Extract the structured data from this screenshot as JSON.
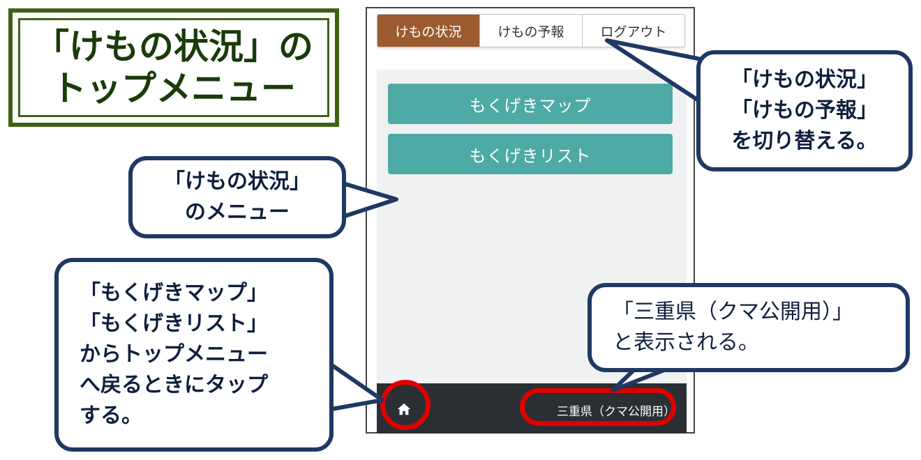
{
  "title": {
    "line1": "「けもの状況」の",
    "line2": "トップメニュー"
  },
  "phone": {
    "tabs": [
      {
        "label": "けもの状況",
        "active": true
      },
      {
        "label": "けもの予報",
        "active": false
      },
      {
        "label": "ログアウト",
        "active": false
      }
    ],
    "menu": {
      "map_button": "もくげきマップ",
      "list_button": "もくげきリスト"
    },
    "footer": {
      "home_icon": "home-icon",
      "region": "三重県（クマ公開用）"
    },
    "colors": {
      "active_tab": "#9c5b2e",
      "menu_button": "#4eaaa4",
      "footer": "#2a2f33",
      "highlight": "#e00000"
    }
  },
  "callouts": {
    "tabs": {
      "line1": "「けもの状況」",
      "line2": "「けもの予報」",
      "line3": "を切り替える。"
    },
    "menu": {
      "line1": "「けもの状況」",
      "line2": "のメニュー"
    },
    "home": {
      "line1": "「もくげきマップ」",
      "line2": "「もくげきリスト」",
      "line3": "からトップメニュー",
      "line4": "へ戻るときにタップ",
      "line5": "する。"
    },
    "region": {
      "line1": "「三重県（クマ公開用）」",
      "line2": "と表示される。"
    }
  }
}
